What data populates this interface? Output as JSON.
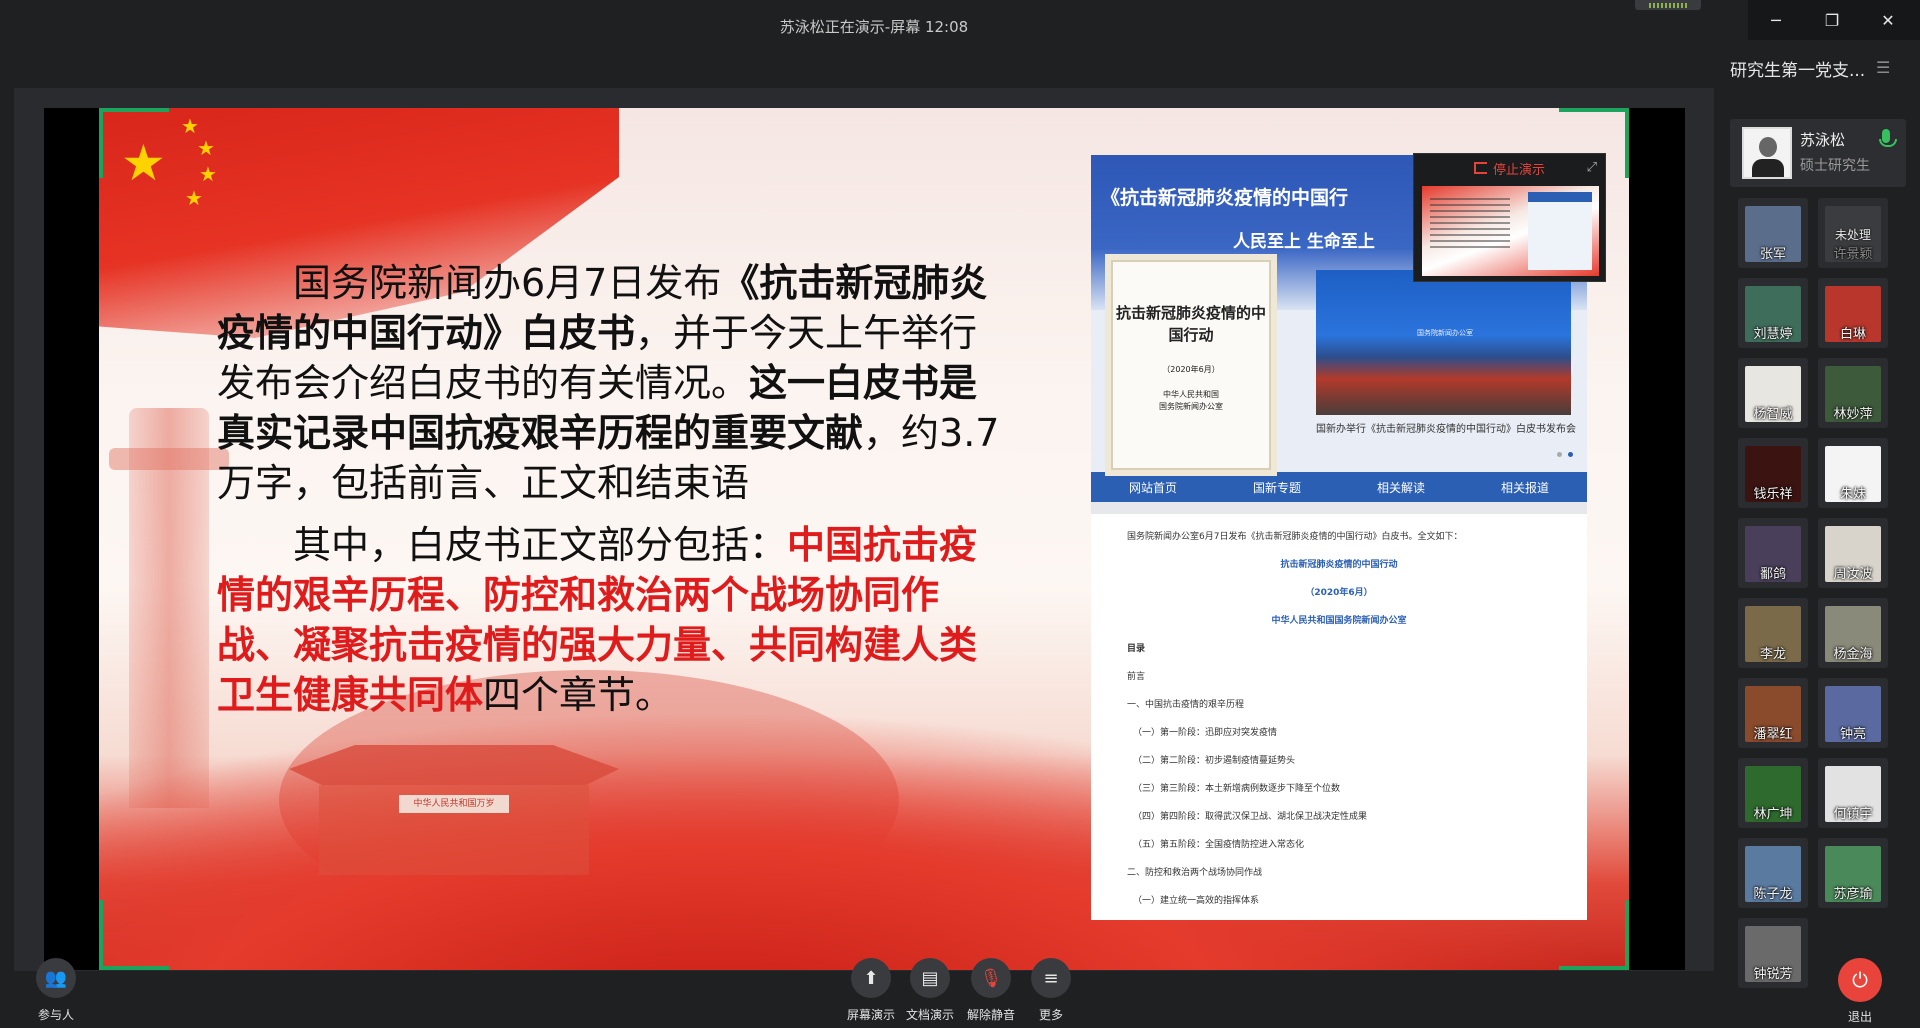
{
  "window": {
    "title": "苏泳松正在演示-屏幕 12:08",
    "minimize": "─",
    "maximize": "❐",
    "close": "✕"
  },
  "slide": {
    "para1_a": "国务院新闻办6月7日发布",
    "para1_b": "《抗击新冠肺炎疫情的中国行动》白皮书",
    "para1_c": "，并于今天上午举行发布会介绍白皮书的有关情况。",
    "para1_d": "这一白皮书是真实记录中国抗疫艰辛历程的重要文献",
    "para1_e": "，约3.7万字，包括前言、正文和结束语",
    "para2_a": "其中，白皮书正文部分包括：",
    "para2_b": "中国抗击疫情的艰辛历程、防控和救治两个战场协同作战、凝聚抗击疫情的强大力量、共同构建人类卫生健康共同体",
    "para2_c": "四个章节。",
    "gate_plaque": "中华人民共和国万岁"
  },
  "webpage": {
    "banner_title": "《抗击新冠肺炎疫情的中国行",
    "banner_slogan": "人民至上  生命至上",
    "book_title": "抗击新冠肺炎疫情的中国行动",
    "book_date": "（2020年6月）",
    "book_publisher_line1": "中华人民共和国",
    "book_publisher_line2": "国务院新闻办公室",
    "photo_sign": "国务院新闻办公室",
    "photo_caption": "国新办举行《抗击新冠肺炎疫情的中国行动》白皮书发布会",
    "nav": [
      "网站首页",
      "国新专题",
      "相关解读",
      "相关报道"
    ],
    "intro": "国务院新闻办公室6月7日发布《抗击新冠肺炎疫情的中国行动》白皮书。全文如下：",
    "doc_title": "抗击新冠肺炎疫情的中国行动",
    "doc_date": "（2020年6月）",
    "doc_publisher": "中华人民共和国国务院新闻办公室",
    "toc_label": "目录",
    "toc": [
      "前言",
      "一、中国抗击疫情的艰辛历程",
      "（一）第一阶段：迅即应对突发疫情",
      "（二）第二阶段：初步遏制疫情蔓延势头",
      "（三）第三阶段：本土新增病例数逐步下降至个位数",
      "（四）第四阶段：取得武汉保卫战、湖北保卫战决定性成果",
      "（五）第五阶段：全国疫情防控进入常态化",
      "二、防控和救治两个战场协同作战",
      "（一）建立统一高效的指挥体系"
    ]
  },
  "mini_preview": {
    "stop_label": "停止演示",
    "expand_icon": "⤢"
  },
  "right_panel": {
    "group_title": "研究生第一党支...",
    "host": {
      "name": "苏泳松",
      "role": "硕士研究生"
    },
    "participants": [
      {
        "name": "张军",
        "color": "#5a6e8c"
      },
      {
        "name": "许景颖",
        "status": "未处理",
        "color": "#3b3c3f"
      },
      {
        "name": "刘慧婷",
        "color": "#3f6d5c"
      },
      {
        "name": "白琳",
        "color": "#b8362c"
      },
      {
        "name": "杨智威",
        "color": "#e8e6e0"
      },
      {
        "name": "林妙萍",
        "color": "#3d5a3a"
      },
      {
        "name": "钱乐祥",
        "color": "#3b1412"
      },
      {
        "name": "朱妹",
        "color": "#f4f4f4"
      },
      {
        "name": "鄱鸽",
        "color": "#4a3f5a"
      },
      {
        "name": "周汝波",
        "color": "#d8d4cc"
      },
      {
        "name": "李龙",
        "color": "#7a6a4a"
      },
      {
        "name": "杨金海",
        "color": "#8a8a7a"
      },
      {
        "name": "潘翠红",
        "color": "#8a4a2c"
      },
      {
        "name": "钟亮",
        "color": "#5a6aa0"
      },
      {
        "name": "林广坤",
        "color": "#2e6a2e"
      },
      {
        "name": "何镇宇",
        "color": "#e2e2e2"
      },
      {
        "name": "陈子龙",
        "color": "#5a7aa0"
      },
      {
        "name": "苏彦瑜",
        "color": "#4a8a5a"
      },
      {
        "name": "钟锐芳",
        "color": "#6a6a6a"
      }
    ]
  },
  "toolbar": {
    "participants_label": "参与人",
    "screen_share_label": "屏幕演示",
    "doc_share_label": "文档演示",
    "unmute_label": "解除静音",
    "more_label": "更多",
    "exit_label": "退出"
  },
  "colors": {
    "accent_red": "#e8443b",
    "accent_green": "#35c15e",
    "slide_red_text": "#e01b1b"
  }
}
